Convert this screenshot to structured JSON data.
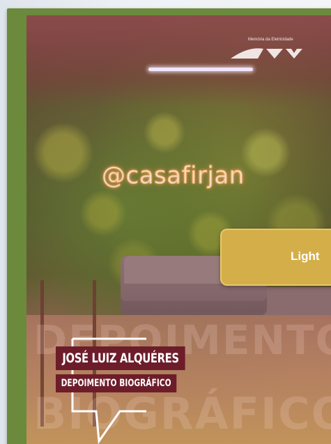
{
  "video": {
    "neon_sign": "@casafirjan",
    "logo_caption": "Memória da Eletricidade",
    "background_words": [
      "DEPOIMENTO",
      "BIOGRÁFICO"
    ]
  },
  "lower_third": {
    "name": "JOSÉ LUIZ ALQUÉRES",
    "subtitle": "DEPOIMENTO BIOGRÁFICO"
  },
  "side_button": {
    "label": "Light"
  },
  "colors": {
    "frame_green": "#6b8a3c",
    "lower_third_bg": "#6d1d2a",
    "button_gold": "#d4ae48"
  }
}
